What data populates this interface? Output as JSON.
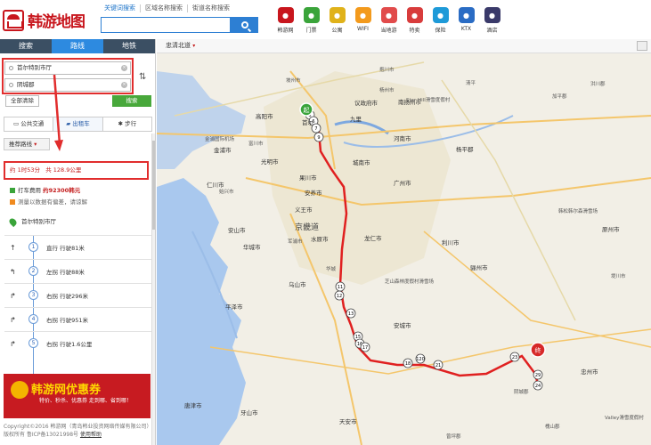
{
  "header": {
    "logo_text": "韩游地图",
    "search_tabs": [
      "关键词搜索",
      "区域名称搜索",
      "街道名称搜索"
    ],
    "search_value": "",
    "categories": [
      {
        "label": "韩游网",
        "icon": "korea-trip-icon",
        "color": "#c8161d"
      },
      {
        "label": "门票",
        "icon": "ticket-icon",
        "color": "#3aa43a"
      },
      {
        "label": "公寓",
        "icon": "apartment-icon",
        "color": "#e0b21a"
      },
      {
        "label": "WIFI",
        "icon": "wifi-icon",
        "color": "#f39a1c"
      },
      {
        "label": "当地游",
        "icon": "local-tour-icon",
        "color": "#e14b4b"
      },
      {
        "label": "特卖",
        "icon": "sale-icon",
        "color": "#d83c3c"
      },
      {
        "label": "保险",
        "icon": "insurance-icon",
        "color": "#1e9ad8"
      },
      {
        "label": "KTX",
        "icon": "ktx-train-icon",
        "color": "#2a6cc4"
      },
      {
        "label": "酒店",
        "icon": "hotel-icon",
        "color": "#3a3a6a"
      }
    ]
  },
  "sidebar": {
    "tabs": [
      "搜索",
      "路线",
      "地铁"
    ],
    "origin": "首尔特别市厅",
    "destination": "阴城郡",
    "clear_label": "全部清除",
    "search_label": "搜索",
    "modes": [
      "公共交通",
      "出租车",
      "步行"
    ],
    "preference": "推荐路线",
    "summary_time": "约 1时53分",
    "summary_distance": "共 128.9公里",
    "taxi_label": "打车费用",
    "taxi_fee": "约92300韩元",
    "taxi_note": "测量以数据有偏差，请谅解",
    "start_name": "首尔特别市厅",
    "steps": [
      {
        "num": "1",
        "text": "直行 行驶81米",
        "arrow": "↑"
      },
      {
        "num": "2",
        "text": "左拐 行驶88米",
        "arrow": "↰"
      },
      {
        "num": "3",
        "text": "右拐 行驶296米",
        "arrow": "↱"
      },
      {
        "num": "4",
        "text": "右拐 行驶951米",
        "arrow": "↱"
      },
      {
        "num": "5",
        "text": "右拐 行驶1.6公里",
        "arrow": "↱"
      }
    ],
    "ad_title": "韩游网优惠券",
    "ad_sub": "特价、秒杀、优惠券 走到哪、省到哪！",
    "footer_text": "Copyright©2016 韩游网（青岛韩业投资网络传媒有限公司）版权所有 鲁ICP备13021998号",
    "footer_link": "使用帮助"
  },
  "map": {
    "area_selector": "忠清北道",
    "start_marker": "起",
    "end_marker": "终",
    "labels": [
      {
        "text": "高阳市",
        "style": "lb"
      },
      {
        "text": "议政府市",
        "style": "lb"
      },
      {
        "text": "南扬州市",
        "style": "lb"
      },
      {
        "text": "九里",
        "style": "lb"
      },
      {
        "text": "河南市",
        "style": "lb"
      },
      {
        "text": "光明市",
        "style": "lb"
      },
      {
        "text": "果川市",
        "style": "lb"
      },
      {
        "text": "城南市",
        "style": "lb"
      },
      {
        "text": "广州市",
        "style": "lb"
      },
      {
        "text": "安养市",
        "style": "lb"
      },
      {
        "text": "义王市",
        "style": "lb"
      },
      {
        "text": "龙仁市",
        "style": "lb"
      },
      {
        "text": "安山市",
        "style": "lb"
      },
      {
        "text": "乌山市",
        "style": "lb"
      },
      {
        "text": "平泽市",
        "style": "lb"
      },
      {
        "text": "安城市",
        "style": "lb"
      },
      {
        "text": "天安市",
        "style": "lb"
      },
      {
        "text": "仁川市",
        "style": "lb"
      },
      {
        "text": "忠州市",
        "style": "lb"
      },
      {
        "text": "水原市",
        "style": "lb"
      },
      {
        "text": "华城市",
        "style": "lb"
      },
      {
        "text": "金浦市",
        "style": "lb"
      },
      {
        "text": "唐津市",
        "style": "lb"
      },
      {
        "text": "牙山市",
        "style": "lb"
      },
      {
        "text": "杨平郡",
        "style": "lb"
      },
      {
        "text": "骊州市",
        "style": "lb"
      },
      {
        "text": "原州市",
        "style": "lb"
      },
      {
        "text": "利川市",
        "style": "lb"
      },
      {
        "text": "首尔",
        "style": "lb"
      },
      {
        "text": "京畿道",
        "style": "prov"
      },
      {
        "text": "金浦国际机场",
        "style": "lbs"
      },
      {
        "text": "Star Hill滑雪度假村",
        "style": "lbs"
      },
      {
        "text": "芝山森林度假村滑雪场",
        "style": "lbs"
      },
      {
        "text": "Valley滑雪度假村",
        "style": "lbs"
      },
      {
        "text": "韩松韩尔森滑雪场",
        "style": "lbs"
      },
      {
        "text": "清平",
        "style": "lbs"
      },
      {
        "text": "加平郡",
        "style": "lbs"
      },
      {
        "text": "洪川郡",
        "style": "lbs"
      },
      {
        "text": "槐山郡",
        "style": "lbs"
      },
      {
        "text": "曾坪郡",
        "style": "lbs"
      },
      {
        "text": "堤川市",
        "style": "lbs"
      },
      {
        "text": "始兴市",
        "style": "lbs"
      },
      {
        "text": "坡州市",
        "style": "lbs"
      },
      {
        "text": "富川市",
        "style": "lbs"
      },
      {
        "text": "军浦市",
        "style": "lbs"
      },
      {
        "text": "阴城郡",
        "style": "lbs"
      },
      {
        "text": "抱川市",
        "style": "lbs"
      },
      {
        "text": "杨州市",
        "style": "lbs"
      },
      {
        "text": "华城",
        "style": "lbs"
      }
    ],
    "route_nodes": [
      "5",
      "6",
      "7",
      "9",
      "11",
      "12",
      "13",
      "15",
      "16",
      "17",
      "18",
      "120",
      "21",
      "23",
      "29",
      "24"
    ]
  }
}
